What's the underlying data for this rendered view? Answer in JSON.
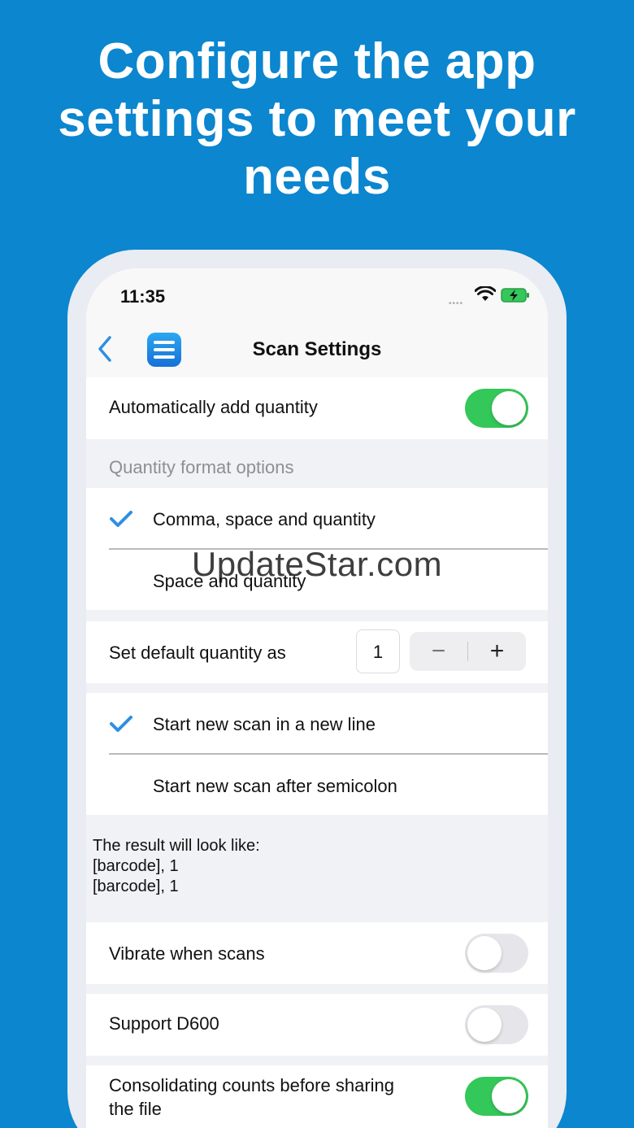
{
  "promo": {
    "headline_line1": "Configure the app",
    "headline_line2": "settings to meet your",
    "headline_line3": "needs"
  },
  "status_bar": {
    "time": "11:35",
    "icons": [
      "cellular-signal-icon",
      "wifi-icon",
      "battery-charging-icon"
    ]
  },
  "nav": {
    "title": "Scan Settings",
    "back_icon": "chevron-left-icon",
    "app_icon": "list-icon"
  },
  "settings": {
    "auto_add_quantity": {
      "label": "Automatically add quantity",
      "on": true
    },
    "quantity_format_header": "Quantity format options",
    "quantity_formats": [
      {
        "label": "Comma, space and quantity",
        "selected": true
      },
      {
        "label": "Space and quantity",
        "selected": false
      }
    ],
    "default_quantity": {
      "label": "Set default quantity as",
      "value": "1",
      "minus": "−",
      "plus": "+"
    },
    "scan_separators": [
      {
        "label": "Start new scan in a new line",
        "selected": true
      },
      {
        "label": "Start new scan after semicolon",
        "selected": false
      }
    ],
    "result_preview": {
      "line1": "The result will look like:",
      "line2": "[barcode], 1",
      "line3": "[barcode], 1"
    },
    "vibrate": {
      "label": "Vibrate when scans",
      "on": false
    },
    "support_d600": {
      "label": "Support D600",
      "on": false
    },
    "consolidate": {
      "label_line1": "Consolidating counts before sharing",
      "label_line2": "the file",
      "on": true
    }
  },
  "colors": {
    "background": "#0b86cf",
    "accent_blue": "#2f8fe0",
    "toggle_on": "#34c759",
    "toggle_off": "#e6e6ea"
  },
  "watermark": "UpdateStar.com"
}
